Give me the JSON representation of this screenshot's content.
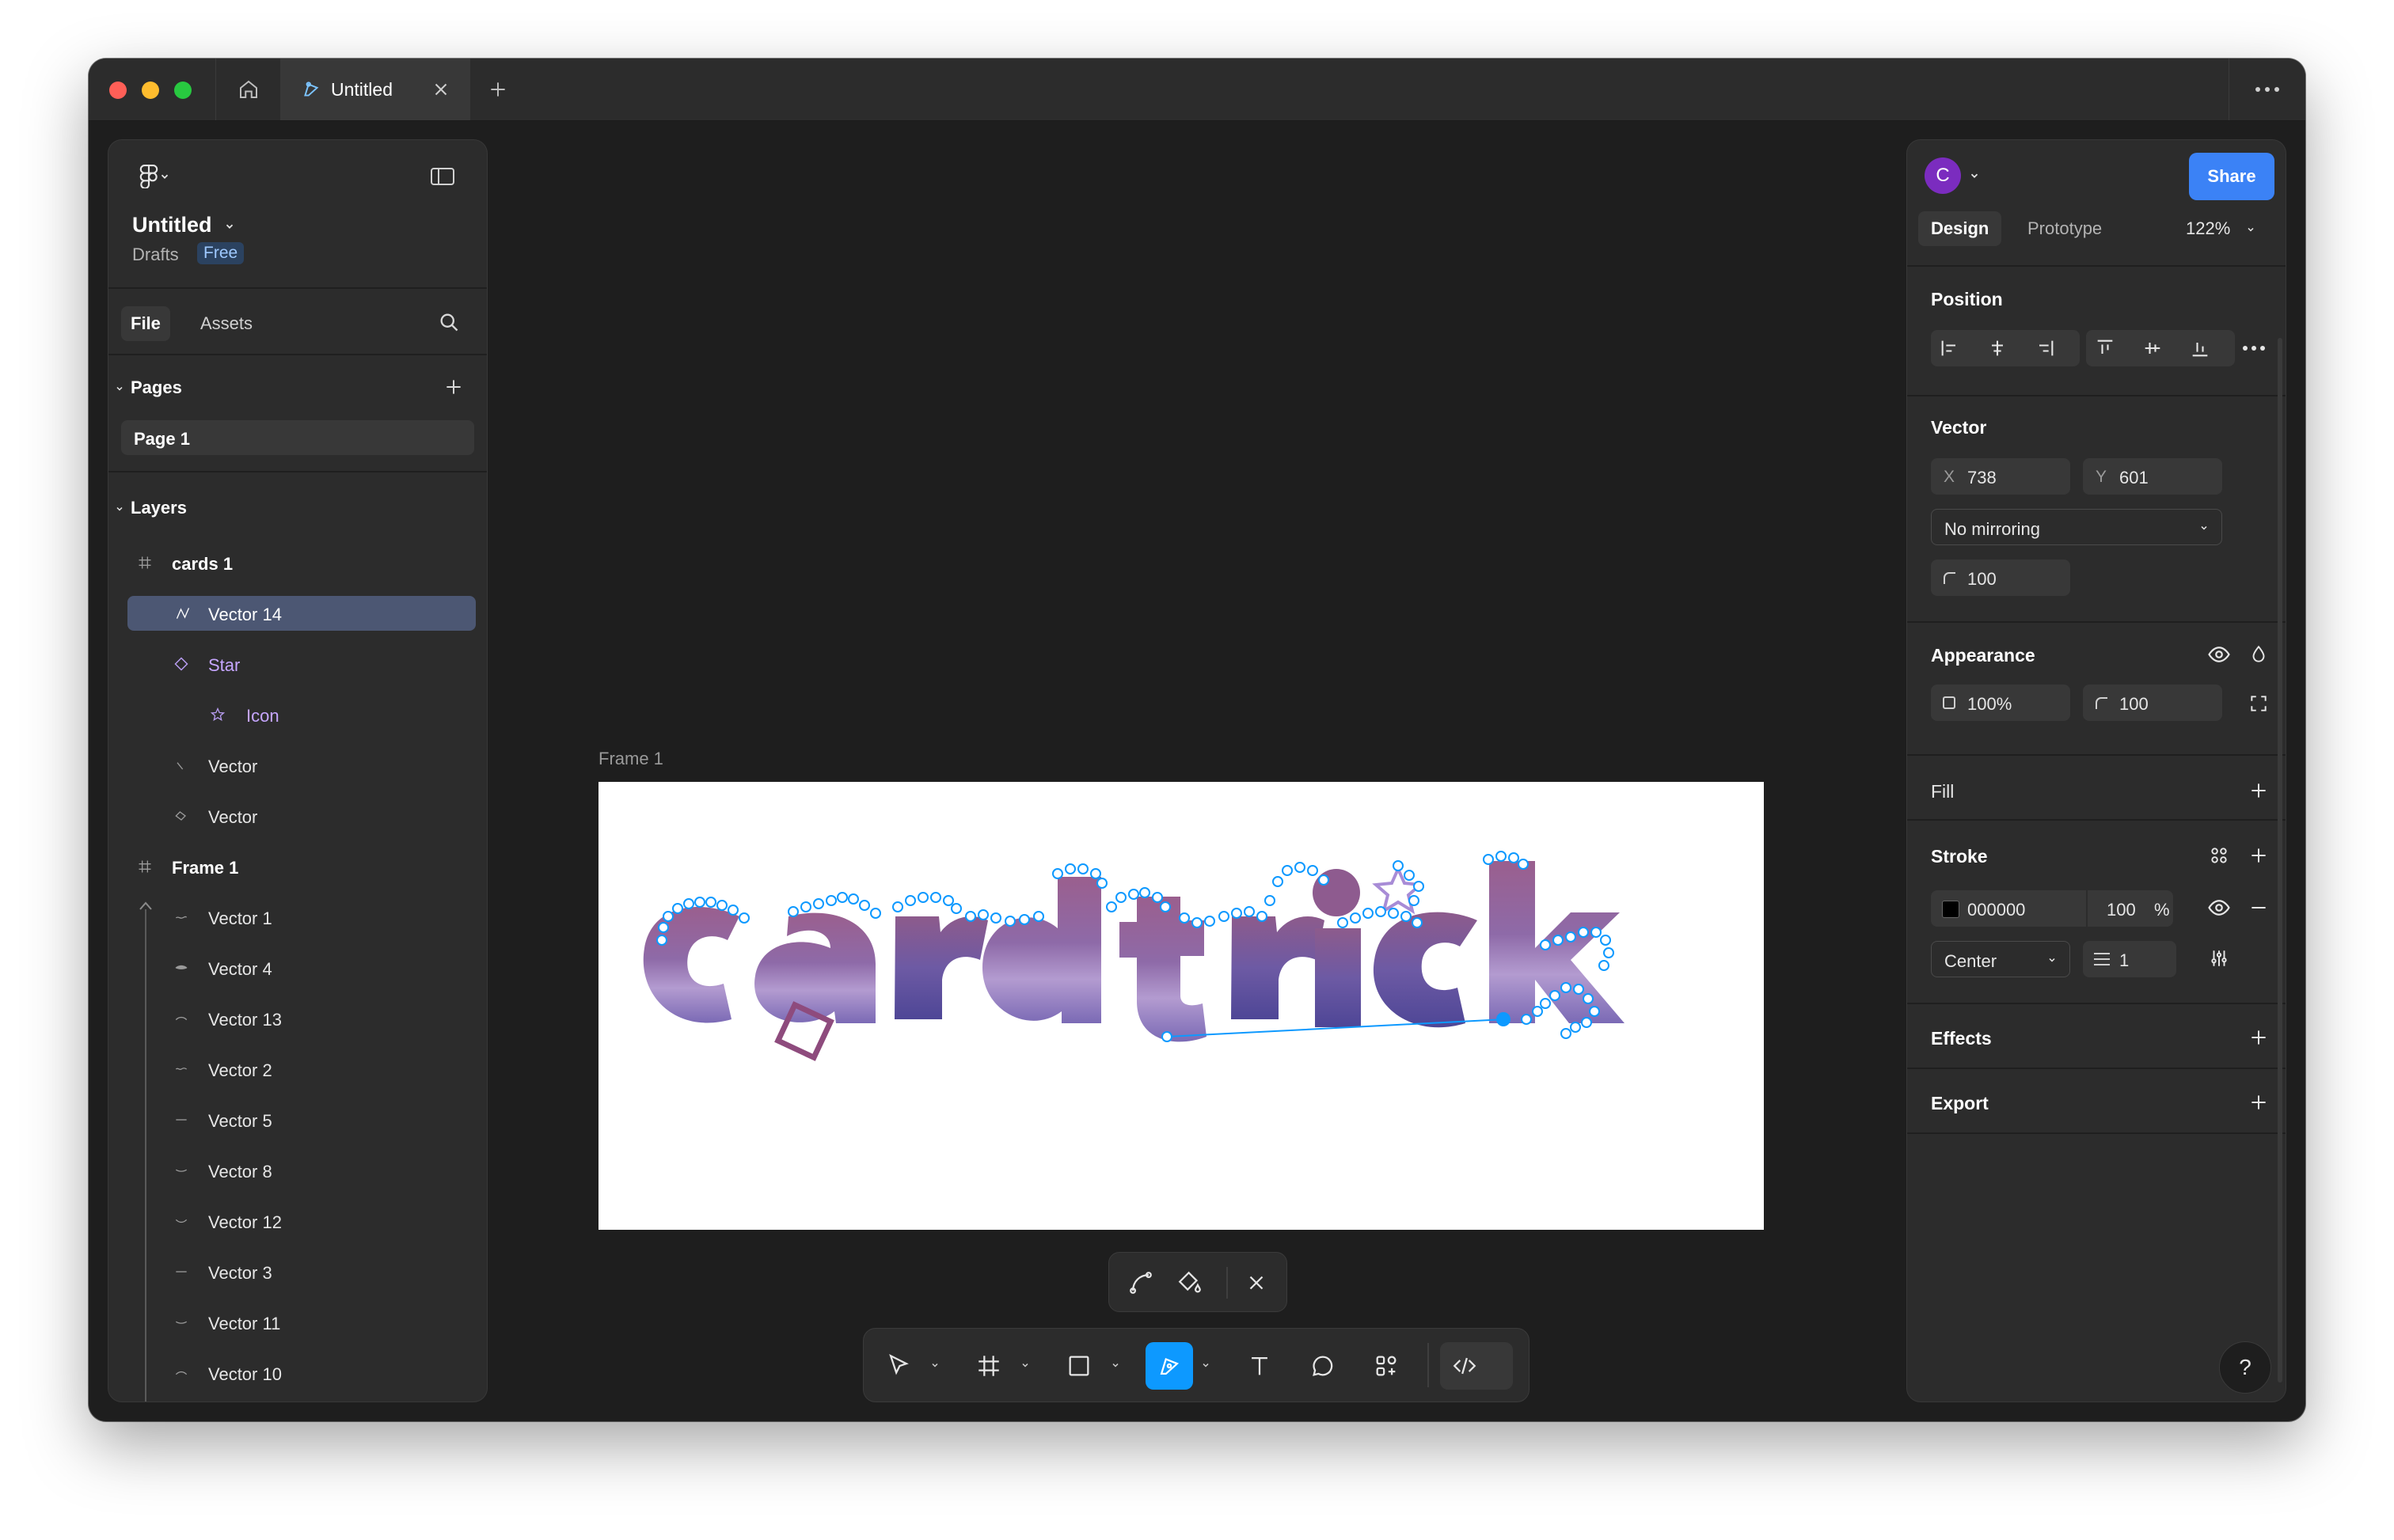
{
  "tab": {
    "title": "Untitled"
  },
  "colors": {
    "accent": "#0d99ff",
    "share": "#3b82f6",
    "avatar": "#7b2cbf",
    "selection": "#4c5773",
    "component": "#c6a6ff"
  },
  "file": {
    "name": "Untitled",
    "location": "Drafts",
    "plan": "Free"
  },
  "left_tabs": {
    "file": "File",
    "assets": "Assets"
  },
  "pages": {
    "header": "Pages",
    "items": [
      "Page 1"
    ]
  },
  "layers": {
    "header": "Layers",
    "items": [
      {
        "label": "cards 1",
        "icon": "frame-icon",
        "selected": false
      },
      {
        "label": "Vector 14",
        "icon": "vector-pen-icon",
        "selected": true
      },
      {
        "label": "Star",
        "icon": "component-instance-icon",
        "selected": false
      },
      {
        "label": "Icon",
        "icon": "star-icon",
        "selected": false
      },
      {
        "label": "Vector",
        "icon": "vector-icon",
        "selected": false
      },
      {
        "label": "Vector",
        "icon": "vector-icon",
        "selected": false
      },
      {
        "label": "Frame 1",
        "icon": "frame-icon",
        "selected": false
      },
      {
        "label": "Vector 1",
        "icon": "vector-icon",
        "selected": false
      },
      {
        "label": "Vector 4",
        "icon": "vector-icon",
        "selected": false
      },
      {
        "label": "Vector 13",
        "icon": "vector-icon",
        "selected": false
      },
      {
        "label": "Vector 2",
        "icon": "vector-icon",
        "selected": false
      },
      {
        "label": "Vector 5",
        "icon": "vector-icon",
        "selected": false
      },
      {
        "label": "Vector 8",
        "icon": "vector-icon",
        "selected": false
      },
      {
        "label": "Vector 12",
        "icon": "vector-icon",
        "selected": false
      },
      {
        "label": "Vector 3",
        "icon": "vector-icon",
        "selected": false
      },
      {
        "label": "Vector 11",
        "icon": "vector-icon",
        "selected": false
      },
      {
        "label": "Vector 10",
        "icon": "vector-icon",
        "selected": false
      }
    ]
  },
  "canvas": {
    "frame_label": "Frame 1"
  },
  "right": {
    "avatar_initial": "C",
    "share": "Share",
    "tabs": {
      "design": "Design",
      "prototype": "Prototype"
    },
    "zoom": "122%",
    "position": {
      "title": "Position"
    },
    "vector": {
      "title": "Vector",
      "x_label": "X",
      "x": "738",
      "y_label": "Y",
      "y": "601",
      "mirroring": "No mirroring",
      "radius": "100"
    },
    "appearance": {
      "title": "Appearance",
      "opacity": "100%",
      "radius": "100"
    },
    "fill": {
      "title": "Fill"
    },
    "stroke": {
      "title": "Stroke",
      "hex": "000000",
      "opacity": "100",
      "unit": "%",
      "align": "Center",
      "weight": "1"
    },
    "effects": {
      "title": "Effects"
    },
    "export": {
      "title": "Export"
    }
  },
  "help": "?"
}
